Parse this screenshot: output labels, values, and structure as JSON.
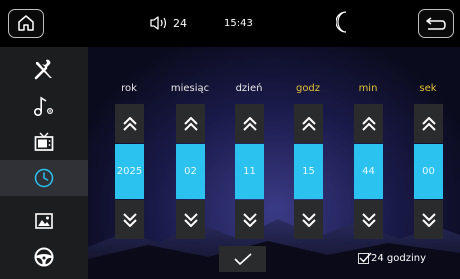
{
  "status_bar": {
    "volume_level": "24",
    "time": "15:43"
  },
  "sidebar": {
    "items": [
      {
        "name": "tools"
      },
      {
        "name": "sound-settings"
      },
      {
        "name": "display"
      },
      {
        "name": "clock"
      },
      {
        "name": "wallpaper"
      },
      {
        "name": "steering-wheel"
      }
    ],
    "active_index": 3
  },
  "columns": [
    {
      "label": "rok",
      "value": "2025"
    },
    {
      "label": "miesiąc",
      "value": "02"
    },
    {
      "label": "dzień",
      "value": "11"
    },
    {
      "label": "godz",
      "value": "15"
    },
    {
      "label": "min",
      "value": "44"
    },
    {
      "label": "sek",
      "value": "00"
    }
  ],
  "format_option": {
    "label": "24 godziny",
    "checked": true
  },
  "colors": {
    "accent": "#2bc2f0",
    "time_label": "#e2c233"
  }
}
